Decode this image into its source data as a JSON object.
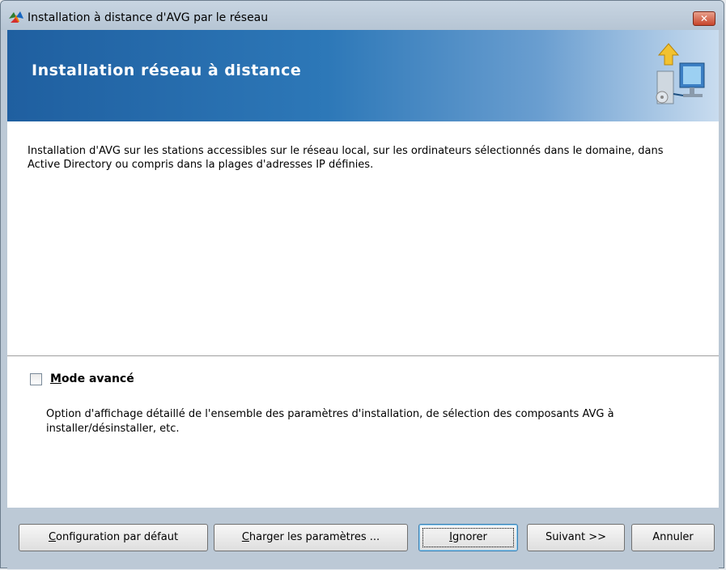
{
  "window": {
    "title": "Installation à distance d'AVG par le réseau",
    "close_icon": "close-icon"
  },
  "header": {
    "title": "Installation réseau à distance",
    "icon": "network-install-icon"
  },
  "content": {
    "intro": "Installation d'AVG sur les stations accessibles sur le réseau local, sur les ordinateurs sélectionnés dans le domaine, dans Active Directory ou compris dans la plages d'adresses IP définies.",
    "advanced_mode": {
      "label_first": "M",
      "label_rest": "ode avancé",
      "checked": false,
      "description": "Option d'affichage détaillé de l'ensemble des paramètres d'installation, de sélection des composants AVG à installer/désinstaller, etc."
    }
  },
  "buttons": {
    "default_config": {
      "first": "C",
      "rest": "onfiguration par défaut"
    },
    "load_settings": {
      "first": "C",
      "rest": "harger les paramètres ..."
    },
    "ignore": {
      "first": "I",
      "rest": "gnorer"
    },
    "next": "Suivant >>",
    "cancel": "Annuler"
  },
  "colors": {
    "header_start": "#1f5fa0",
    "header_end": "#c9dcef",
    "window_frame": "#bcc9d6"
  }
}
